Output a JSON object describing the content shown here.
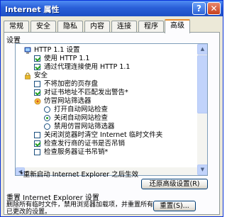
{
  "window": {
    "title": "Internet 属性",
    "help_label": "?",
    "close_label": "✕"
  },
  "tabs": [
    "常规",
    "安全",
    "隐私",
    "内容",
    "连接",
    "程序",
    "高级"
  ],
  "active_tab": "高级",
  "settings_legend": "设置",
  "settings": {
    "items": [
      {
        "type": "icon",
        "icon": "computer-icon",
        "label": "HTTP 1.1 设置"
      },
      {
        "type": "checkbox",
        "checked": true,
        "label": "使用 HTTP 1.1"
      },
      {
        "type": "checkbox",
        "checked": true,
        "label": "通过代理连接使用 HTTP 1.1"
      },
      {
        "type": "icon",
        "icon": "lock-icon",
        "label": "安全"
      },
      {
        "type": "checkbox",
        "checked": false,
        "label": "不将加密的页存盘"
      },
      {
        "type": "checkbox",
        "checked": true,
        "label": "对证书地址不匹配发出警告*"
      },
      {
        "type": "icon",
        "icon": "phishing-filter-icon",
        "label": "仿冒网站筛选器"
      },
      {
        "type": "radio",
        "checked": false,
        "label": "打开自动网站检查"
      },
      {
        "type": "radio",
        "checked": true,
        "label": "关闭自动网站检查"
      },
      {
        "type": "radio",
        "checked": false,
        "label": "禁用仿冒网站筛选器"
      },
      {
        "type": "checkbox",
        "checked": false,
        "label": "关闭浏览器时清空 Internet 临时文件夹"
      },
      {
        "type": "checkbox",
        "checked": true,
        "label": "检查发行商的证书是否吊销"
      },
      {
        "type": "checkbox",
        "checked": false,
        "label": "检查服务器证书吊销*"
      }
    ]
  },
  "restart_note": "*重新启动 Internet Explorer 之后生效",
  "restore_button": "还原高级设置(R)",
  "reset": {
    "title": "重置 Internet Explorer 设置",
    "description": "删除所有临时文件，禁用浏览器加载项，并重置所有已更改的设置。",
    "button": "重置(S)..."
  },
  "colors": {
    "title_bar": "#2a5fd8",
    "active_tab_accent": "#e68b2c",
    "check_mark": "#21a121"
  }
}
